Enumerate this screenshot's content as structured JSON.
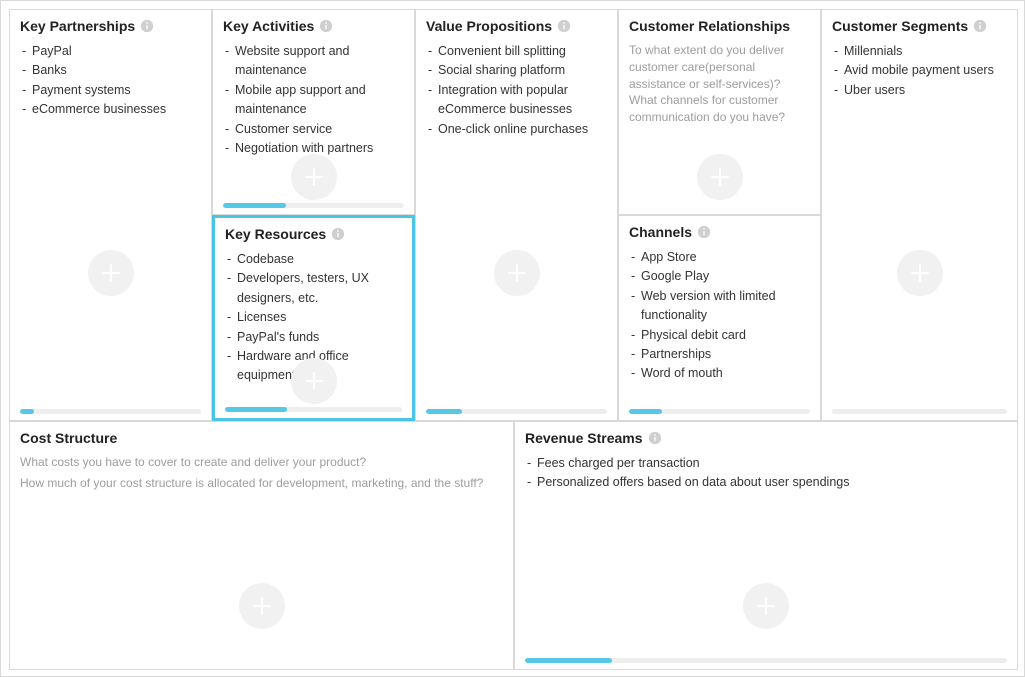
{
  "cells": {
    "keyPartnerships": {
      "title1": "Key",
      "title2": "Partnerships",
      "items": [
        "PayPal",
        "Banks",
        "Payment systems",
        "eCommerce businesses"
      ]
    },
    "keyActivities": {
      "title1": "Key",
      "title2": "Activities",
      "items": [
        "Website support and maintenance",
        "Mobile app support and maintenance",
        "Customer service",
        "Negotiation with partners"
      ]
    },
    "keyResources": {
      "title1": "Key",
      "title2": "Resources",
      "items": [
        "Codebase",
        "Developers, testers, UX designers, etc.",
        "Licenses",
        "PayPal's funds",
        "Hardware and office equipment"
      ]
    },
    "valuePropositions": {
      "title1": "Value",
      "title2": "Propositions",
      "items": [
        "Convenient bill splitting",
        "Social sharing platform",
        "Integration with popular eCommerce businesses",
        "One-click online purchases"
      ]
    },
    "customerRelationships": {
      "title": "Customer Relationships",
      "hint": "To what extent do you deliver customer care(personal assistance or self-services)? What channels for customer communication do you have?"
    },
    "channels": {
      "title": "Channels",
      "items": [
        "App Store",
        "Google Play",
        "Web version with limited functionality",
        "Physical debit card",
        "Partnerships",
        "Word of mouth"
      ]
    },
    "customerSegments": {
      "title1": "Customer",
      "title2": "Segments",
      "items": [
        "Millennials",
        "Avid mobile payment users",
        "Uber users"
      ]
    },
    "costStructure": {
      "title": "Cost Structure",
      "hint1": "What costs you have to cover to create and deliver your product?",
      "hint2": "How much of your cost structure is allocated for development, marketing, and the stuff?"
    },
    "revenueStreams": {
      "title1": "Revenue",
      "title2": "Streams",
      "items": [
        "Fees charged per transaction",
        "Personalized offers based on data about user spendings"
      ]
    }
  },
  "progress": {
    "keyPartnerships": 8,
    "keyActivities": 35,
    "keyResources": 35,
    "valuePropositions": 20,
    "customerRelationships": 0,
    "channels": 18,
    "customerSegments": 0,
    "costStructure": 0,
    "revenueStreams": 18
  }
}
